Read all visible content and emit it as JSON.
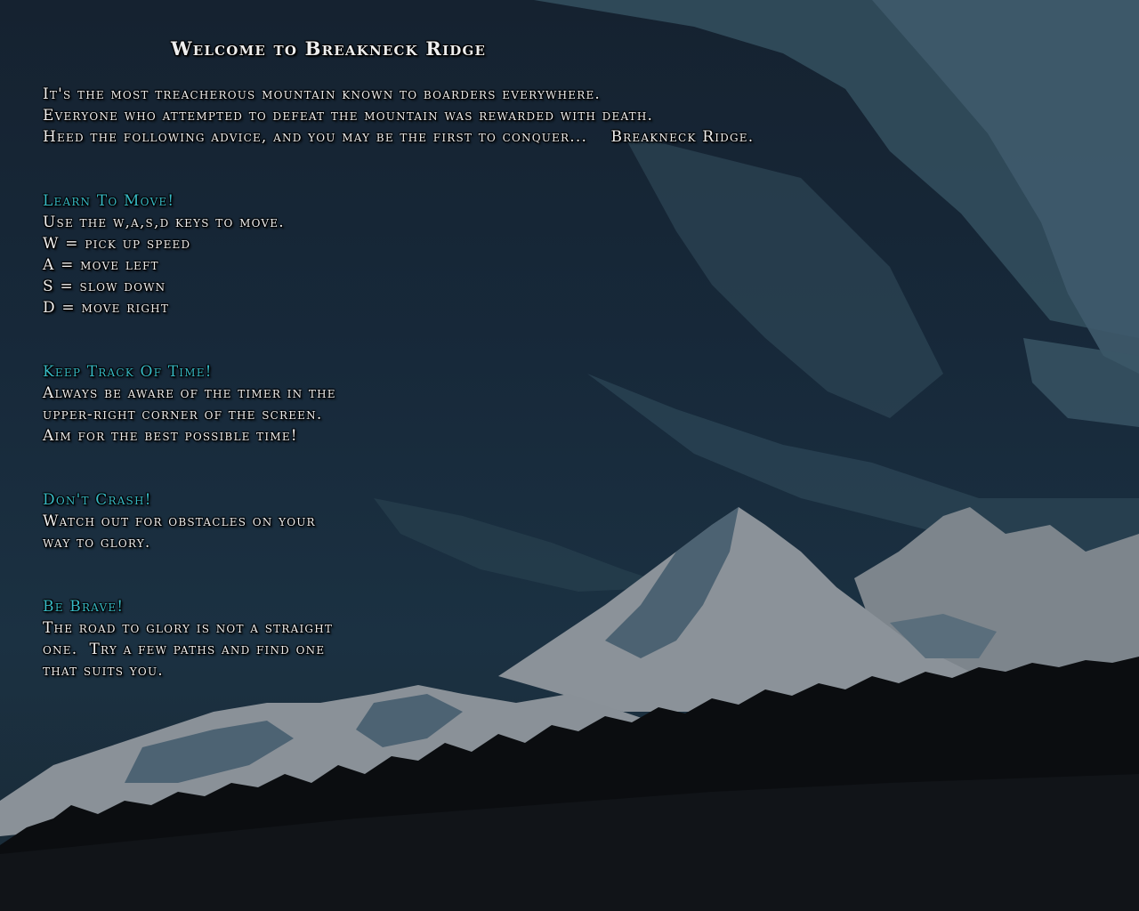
{
  "title": "Welcome to Breakneck Ridge",
  "intro": {
    "line1": "It's the most treacherous mountain known to boarders everywhere.",
    "line2": "Everyone who attempted to defeat the mountain was rewarded with death.",
    "line3": "Heed the following advice, and you may be the first to conquer...    Breakneck Ridge."
  },
  "sections": {
    "move": {
      "heading": "Learn To Move!",
      "lines": [
        "Use the w,a,s,d keys to move.",
        "W = pick up speed",
        "A = move left",
        "S = slow down",
        "D = move right"
      ]
    },
    "time": {
      "heading": "Keep Track Of Time!",
      "lines": [
        "Always be aware of the timer in the",
        "upper-right corner of the screen.",
        "Aim for the best possible time!"
      ]
    },
    "crash": {
      "heading": "Don't Crash!",
      "lines": [
        "Watch out for obstacles on your",
        "way to glory."
      ]
    },
    "brave": {
      "heading": "Be Brave!",
      "lines": [
        "The road to glory is not a straight",
        "one.  Try a few paths and find one",
        "that suits you."
      ]
    }
  },
  "colors": {
    "heading": "#37b9c4",
    "text": "#eeeeee",
    "sky_dark": "#152230",
    "sky_light": "#3f5a6c",
    "snow": "#8a9198",
    "snow_shadow": "#4d6373",
    "trees": "#0b0d10"
  }
}
